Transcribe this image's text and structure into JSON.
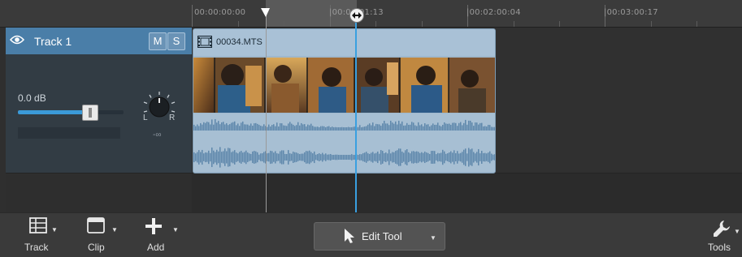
{
  "ruler": {
    "labels": [
      "00:00:00:00",
      "|00:00:01:13",
      "|00:02:00:04",
      "|00:03:00:17"
    ]
  },
  "track": {
    "name": "Track 1",
    "mute_label": "M",
    "solo_label": "S",
    "volume_db": "0.0 dB",
    "volume_level": 0.68,
    "pan_left": "L",
    "pan_right": "R",
    "pan_value": "-∞"
  },
  "clip": {
    "filename": "00034.MTS"
  },
  "toolbar": {
    "track_label": "Track",
    "clip_label": "Clip",
    "add_label": "Add",
    "edit_tool_label": "Edit Tool",
    "tools_label": "Tools"
  },
  "colors": {
    "track_header": "#4a7ea8",
    "clip": "#9fb8cd",
    "playhead": "#3aa0e0",
    "waveform": "#5e87ab"
  },
  "icons": [
    "eye-icon",
    "film-icon",
    "pan-knob-icon",
    "track-grid-icon",
    "clip-icon",
    "plus-icon",
    "cursor-icon",
    "wrench-icon"
  ]
}
